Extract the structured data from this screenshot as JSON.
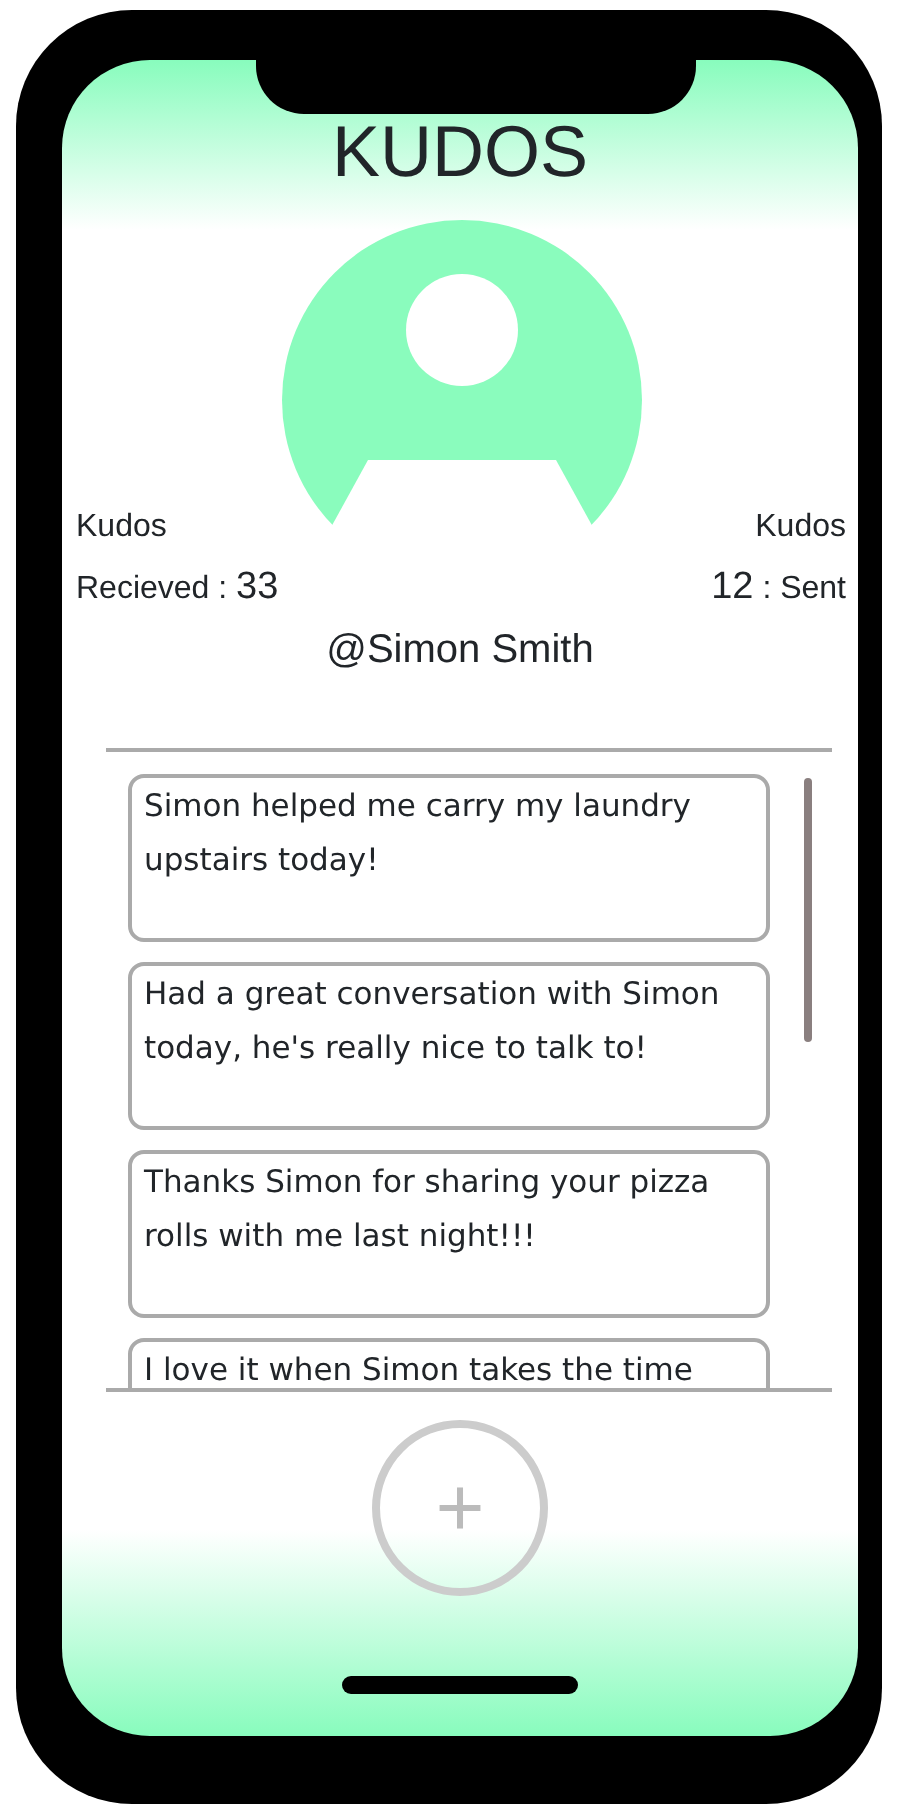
{
  "header": {
    "title": "KUDOS"
  },
  "profile": {
    "username": "@Simon Smith",
    "received": {
      "title": "Kudos",
      "label": "Recieved :",
      "count": "33"
    },
    "sent": {
      "title": "Kudos",
      "count": "12",
      "label": ": Sent"
    }
  },
  "messages": [
    {
      "text": "Simon helped me carry my laundry upstairs today!"
    },
    {
      "text": "Had a great conversation with Simon today, he's really nice to talk to!"
    },
    {
      "text": "Thanks Simon for sharing your pizza rolls with me last night!!!"
    },
    {
      "text": "I love it when Simon takes the time"
    }
  ],
  "add_button": {
    "label": "+"
  }
}
